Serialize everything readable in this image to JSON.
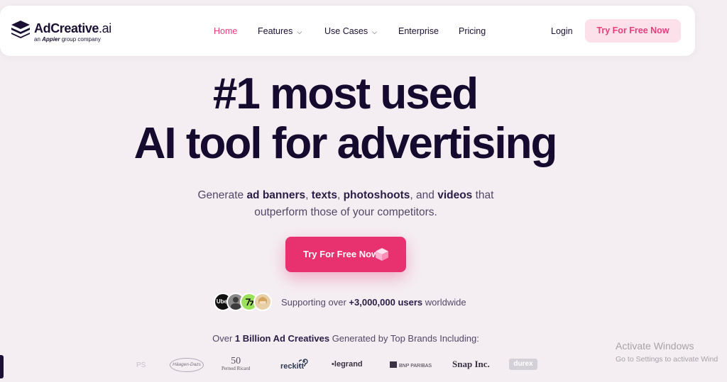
{
  "nav": {
    "logo": {
      "brand": "AdCreative",
      "suffix": ".ai",
      "tagline_prefix": "an",
      "tagline_company": "Appier",
      "tagline_suffix": "group company"
    },
    "items": [
      {
        "label": "Home",
        "active": true
      },
      {
        "label": "Features",
        "dropdown": true
      },
      {
        "label": "Use Cases",
        "dropdown": true
      },
      {
        "label": "Enterprise"
      },
      {
        "label": "Pricing"
      }
    ],
    "login": "Login",
    "cta": "Try For Free Now"
  },
  "hero": {
    "headline_line1": "#1 most used",
    "headline_line2": "AI tool for advertising",
    "sub": {
      "t1": "Generate ",
      "b1": "ad banners",
      "t2": ", ",
      "b2": "texts",
      "t3": ", ",
      "b3": "photoshoots",
      "t4": ", and ",
      "b4": "videos",
      "t5": " that",
      "line2": "outperform those of your competitors."
    },
    "cta": "Try For Free Now"
  },
  "social_proof": {
    "avatars": [
      "Uber",
      "",
      "",
      ""
    ],
    "prefix": "Supporting over ",
    "count": "+3,000,000 users",
    "suffix": " worldwide"
  },
  "brands": {
    "title_prefix": "Over ",
    "title_bold": "1 Billion Ad Creatives",
    "title_suffix": " Generated by Top Brands Including:",
    "logos": {
      "faded": "PS",
      "haagen_dazs": "Häagen-Dazs",
      "pernod_num": "50",
      "pernod_name": "Pernod Ricard",
      "reckitt": "reckitt",
      "legrand": "legrand",
      "bnp": "BNP PARIBAS",
      "snap": "Snap Inc.",
      "durex": "durex"
    }
  },
  "watermark": {
    "title": "Activate Windows",
    "sub": "Go to Settings to activate Wind"
  },
  "colors": {
    "accent": "#e83e7a",
    "cta_bg": "#e8316f",
    "page_bg": "#f4eef2",
    "text_dark": "#140b2e"
  }
}
